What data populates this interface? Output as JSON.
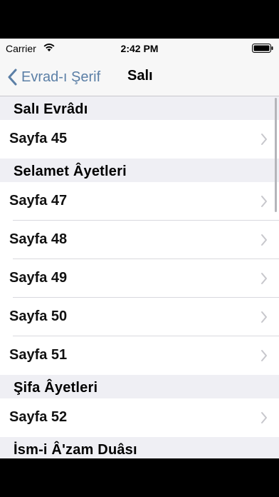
{
  "status": {
    "carrier": "Carrier",
    "time": "2:42 PM"
  },
  "nav": {
    "back_label": "Evrad-ı Şerif",
    "title": "Salı"
  },
  "sections": [
    {
      "header": "Salı Evrâdı",
      "rows": [
        "Sayfa 45"
      ]
    },
    {
      "header": "Selamet Âyetleri",
      "rows": [
        "Sayfa 47",
        "Sayfa 48",
        "Sayfa 49",
        "Sayfa 50",
        "Sayfa 51"
      ]
    },
    {
      "header": "Şifa Âyetleri",
      "rows": [
        "Sayfa 52"
      ]
    },
    {
      "header": "İsm-i Â'zam Duâsı",
      "rows": []
    }
  ],
  "colors": {
    "accent": "#5b7fa6",
    "background": "#efeff4",
    "chevron": "#c7c7cc"
  }
}
